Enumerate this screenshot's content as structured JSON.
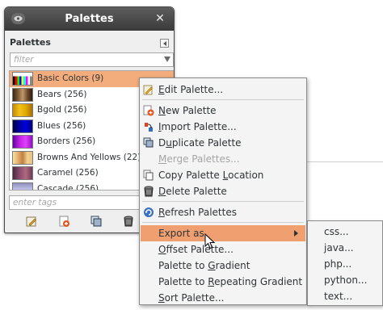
{
  "window": {
    "title": "Palettes",
    "close_glyph": "✕",
    "dock_title": "Palettes",
    "filter_placeholder": "filter",
    "tags_placeholder": "enter tags"
  },
  "palettes": [
    {
      "label": "Basic Colors (9)",
      "selected": true,
      "swatch": "basic"
    },
    {
      "label": "Bears (256)",
      "selected": false,
      "swatch": "bears"
    },
    {
      "label": "Bgold (256)",
      "selected": false,
      "swatch": "bgold"
    },
    {
      "label": "Blues (256)",
      "selected": false,
      "swatch": "blues"
    },
    {
      "label": "Borders (256)",
      "selected": false,
      "swatch": "borders"
    },
    {
      "label": "Browns And Yellows (22)",
      "selected": false,
      "swatch": "browns"
    },
    {
      "label": "Caramel (256)",
      "selected": false,
      "swatch": "caramel"
    },
    {
      "label": "Cascade (256)",
      "selected": false,
      "swatch": "cascade"
    }
  ],
  "toolbar_icons": [
    "edit-palette-icon",
    "new-palette-icon",
    "duplicate-palette-icon",
    "delete-palette-icon"
  ],
  "menu": {
    "items": [
      {
        "pre": "",
        "u": "E",
        "post": "dit Palette...",
        "icon": "edit-icon",
        "disabled": false
      },
      {
        "pre": "",
        "u": "N",
        "post": "ew Palette",
        "icon": "new-icon",
        "disabled": false
      },
      {
        "pre": "",
        "u": "I",
        "post": "mport Palette...",
        "icon": "import-icon",
        "disabled": false
      },
      {
        "pre": "D",
        "u": "u",
        "post": "plicate Palette",
        "icon": "duplicate-icon",
        "disabled": false
      },
      {
        "pre": "",
        "u": "M",
        "post": "erge Palettes...",
        "icon": "",
        "disabled": true
      },
      {
        "pre": "Copy Palette ",
        "u": "L",
        "post": "ocation",
        "icon": "copy-icon",
        "disabled": false
      },
      {
        "pre": "",
        "u": "D",
        "post": "elete Palette",
        "icon": "delete-icon",
        "disabled": false
      },
      {
        "pre": "",
        "u": "R",
        "post": "efresh Palettes",
        "icon": "refresh-icon",
        "disabled": false
      },
      {
        "pre": "Export as",
        "u": "",
        "post": "",
        "icon": "",
        "disabled": false,
        "submenu": true
      },
      {
        "pre": "",
        "u": "O",
        "post": "ffset Palette...",
        "icon": "",
        "disabled": false
      },
      {
        "pre": "Palette to ",
        "u": "G",
        "post": "radient",
        "icon": "",
        "disabled": false
      },
      {
        "pre": "Palette to ",
        "u": "R",
        "post": "epeating Gradient",
        "icon": "",
        "disabled": false
      },
      {
        "pre": "",
        "u": "S",
        "post": "ort Palette...",
        "icon": "",
        "disabled": false
      }
    ]
  },
  "submenu": {
    "items": [
      "css...",
      "java...",
      "php...",
      "python...",
      "text..."
    ]
  },
  "colors": {
    "selection": "#f3ad7d",
    "menu_highlight": "#f0a070",
    "titlebar": "#4a4a4a"
  }
}
